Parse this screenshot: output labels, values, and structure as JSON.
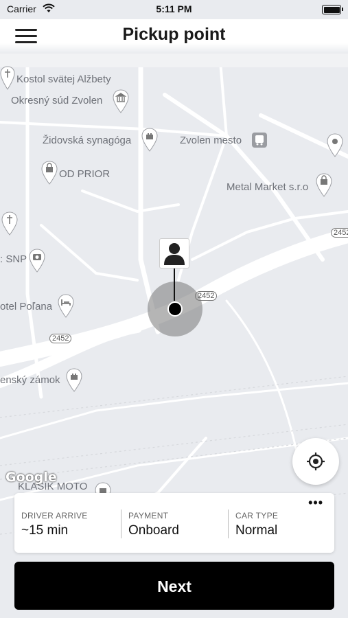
{
  "status_bar": {
    "carrier": "Carrier",
    "time": "5:11 PM"
  },
  "header": {
    "title": "Pickup point"
  },
  "map": {
    "labels": {
      "kostol": "Kostol svätej Alžbety",
      "sud": "Okresný súd Zvolen",
      "synagoga": "Židovská synagóga",
      "zvolen_mesto": "Zvolen mesto",
      "od_prior": "OD PRIOR",
      "metal_market": "Metal Market s.r.o",
      "snp": ": SNP",
      "polana": "otel Poľana",
      "zamok": "enský zámok",
      "klasik": "KLASIK MOTO"
    },
    "road_shields": {
      "r1": "2452",
      "r2": "2452",
      "r3": "2452"
    },
    "attribution": "Google"
  },
  "info_card": {
    "more_label": "•••",
    "driver_arrive": {
      "caption": "DRIVER ARRIVE",
      "value": "~15 min"
    },
    "payment": {
      "caption": "PAYMENT",
      "value": "Onboard"
    },
    "car_type": {
      "caption": "CAR TYPE",
      "value": "Normal"
    }
  },
  "actions": {
    "next_label": "Next"
  },
  "colors": {
    "accent": "#000000",
    "map_background": "#e9ebef"
  }
}
